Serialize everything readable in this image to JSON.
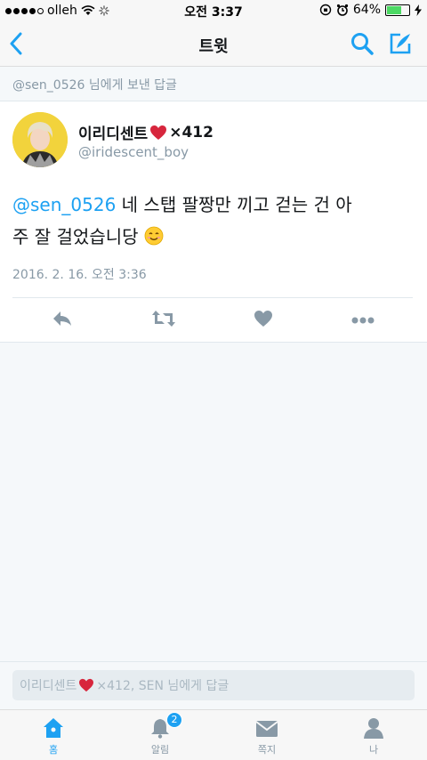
{
  "status_bar": {
    "carrier": "olleh",
    "time": "오전 3:37",
    "battery": "64%",
    "signal_dots_filled": 4,
    "signal_dots_total": 5
  },
  "header": {
    "title": "트윗"
  },
  "reply_context": {
    "text": "@sen_0526 님에게 보낸 답글"
  },
  "tweet": {
    "display_name": "이리디센트",
    "name_suffix": "×412",
    "handle": "@iridescent_boy",
    "mention": "@sen_0526",
    "body_line1": " 네 스탭 팔짱만 끼고 걷는 건 아",
    "body_line2": "주 잘 걸었습니당",
    "timestamp": "2016. 2. 16. 오전 3:36"
  },
  "reply_bar": {
    "placeholder_prefix": "이리디센트",
    "placeholder_suffix": "×412, SEN 님에게 답글"
  },
  "tabs": [
    {
      "label": "홈",
      "icon": "home-icon",
      "active": true
    },
    {
      "label": "알림",
      "icon": "bell-icon",
      "badge": "2",
      "active": false
    },
    {
      "label": "쪽지",
      "icon": "envelope-icon",
      "active": false
    },
    {
      "label": "나",
      "icon": "person-icon",
      "active": false
    }
  ],
  "colors": {
    "accent": "#1DA1F2",
    "text_secondary": "#8899A6",
    "action_icon": "#8899A6",
    "heart": "#E0245E",
    "battery_fill": "#4CD964"
  }
}
